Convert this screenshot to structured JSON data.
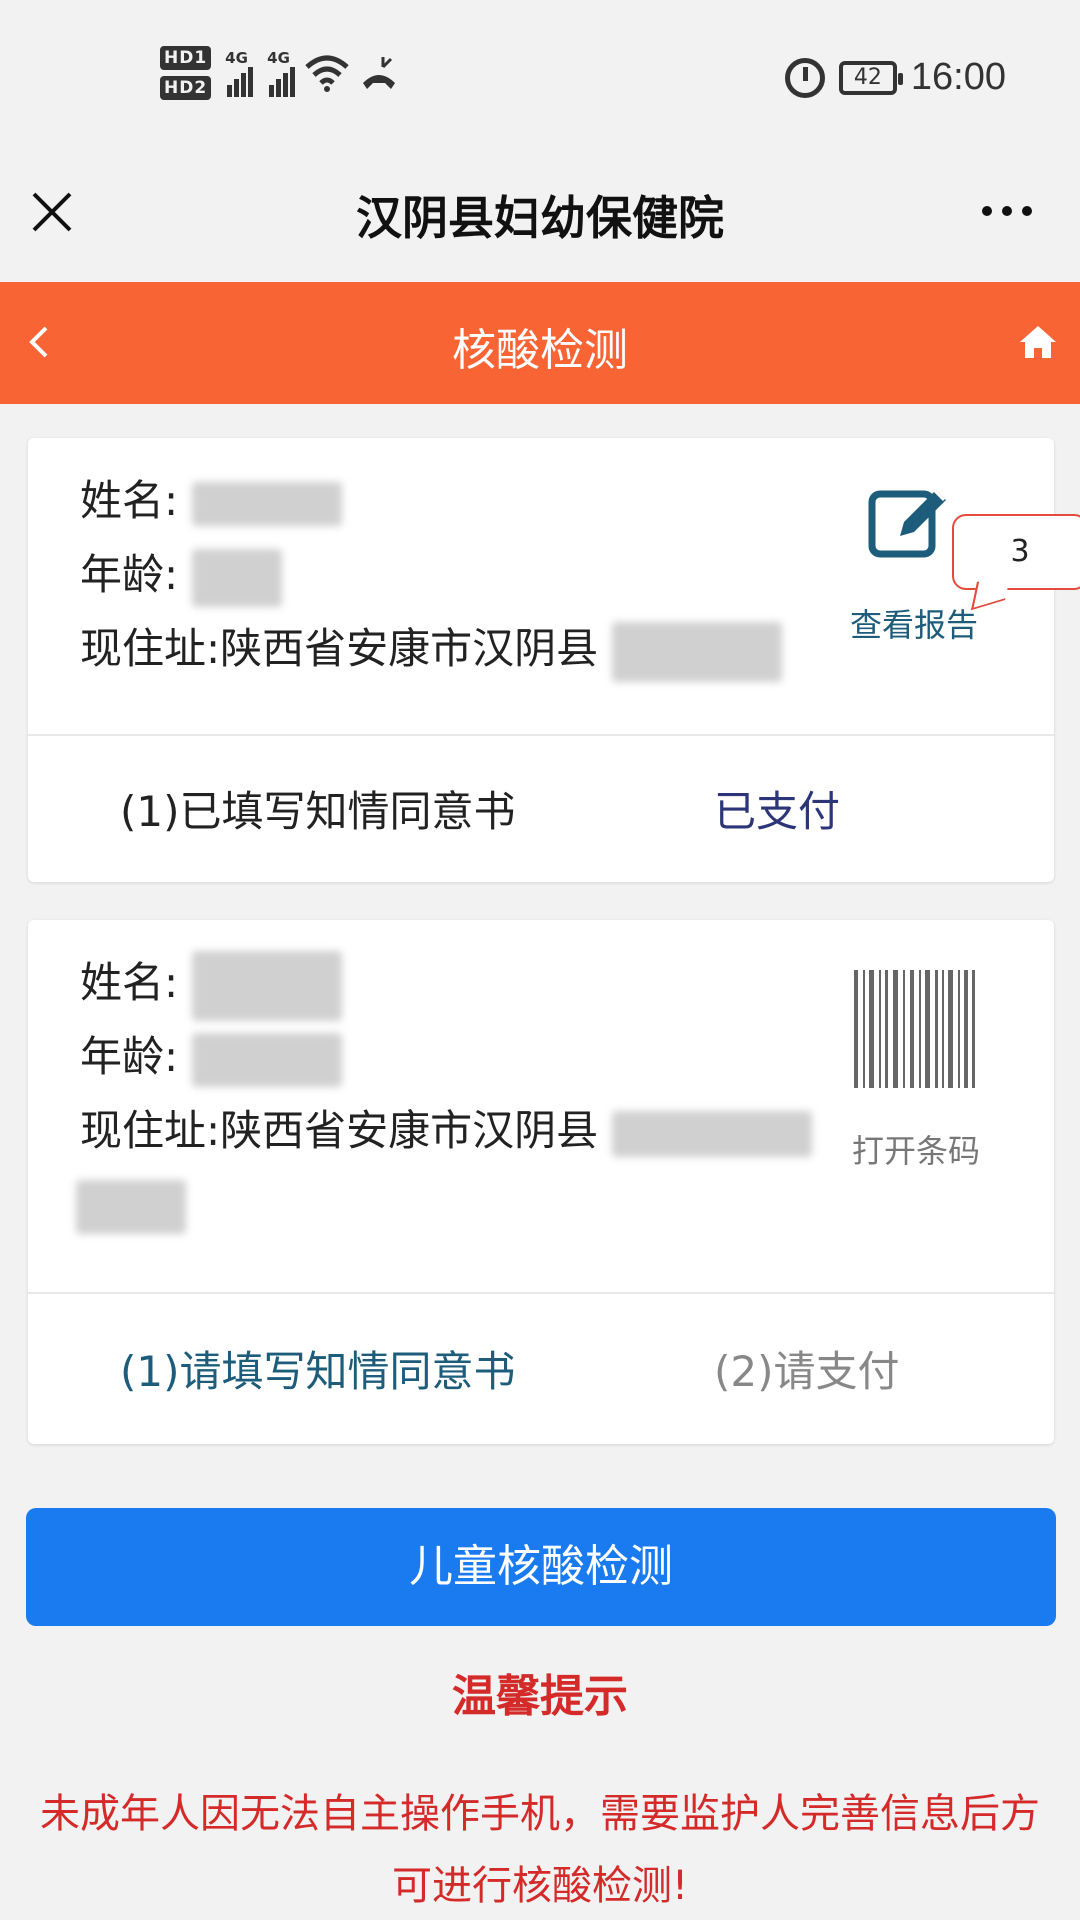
{
  "status_bar": {
    "hd1": "HD1",
    "hd2": "HD2",
    "network1": "4G",
    "network2": "4G",
    "battery": "42",
    "time": "16:00",
    "icons": [
      "signal-icon",
      "wifi-icon",
      "call-icon",
      "alarm-icon",
      "battery-icon"
    ]
  },
  "titlebar": {
    "title": "汉阴县妇幼保健院",
    "close_icon": "close-icon",
    "more_icon": "more-icon"
  },
  "header": {
    "title": "核酸检测",
    "back_icon": "chevron-left-icon",
    "home_icon": "home-icon",
    "color": "#f96435"
  },
  "records": [
    {
      "name_label": "姓名:",
      "age_label": "年龄:",
      "address_label": "现住址:陕西省安康市汉阴县",
      "action_label": "查看报告",
      "badge": "3",
      "consent": "(1)已填写知情同意书",
      "payment": "已支付"
    },
    {
      "name_label": "姓名:",
      "age_label": "年龄:",
      "address_label": "现住址:陕西省安康市汉阴县",
      "action_label": "打开条码",
      "consent": "(1)请填写知情同意书",
      "payment": "(2)请支付"
    }
  ],
  "button": {
    "label": "儿童核酸检测",
    "color": "#1a7bf0"
  },
  "tip": {
    "title": "温馨提示",
    "text": "未成年人因无法自主操作手机，需要监护人完善信息后方可进行核酸检测!"
  }
}
